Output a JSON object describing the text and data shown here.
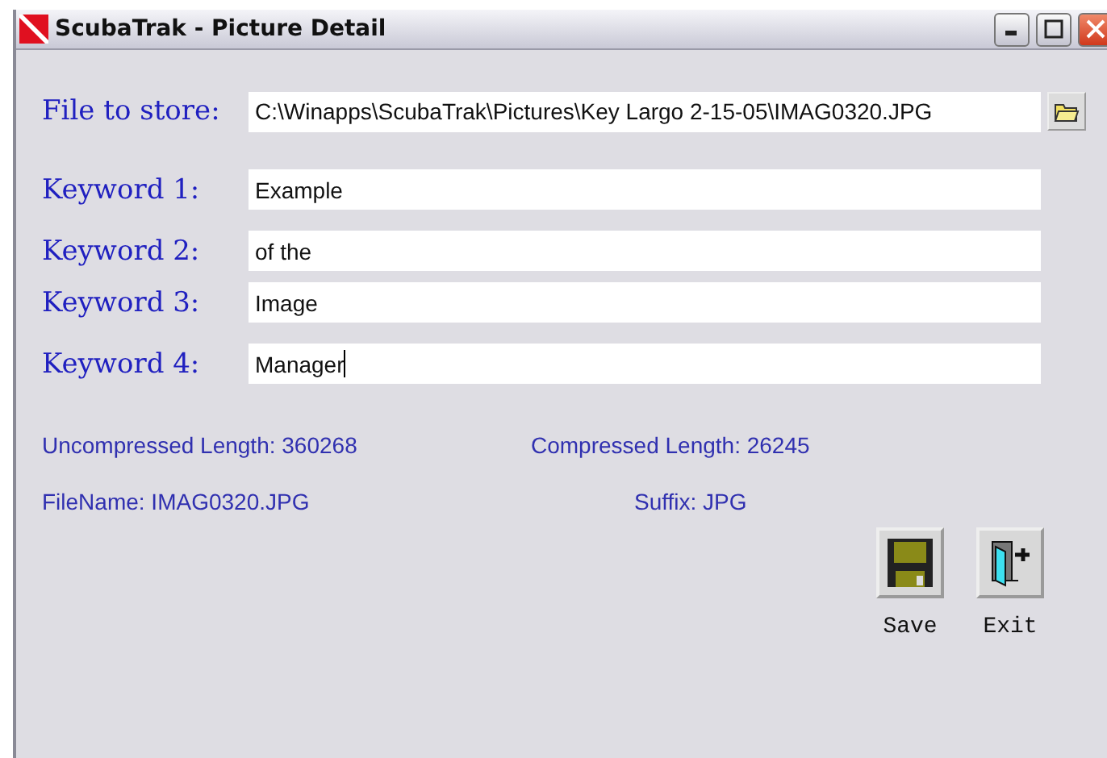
{
  "window": {
    "title": "ScubaTrak - Picture Detail"
  },
  "file_field": {
    "label": "File to store:",
    "value": "C:\\Winapps\\ScubaTrak\\Pictures\\Key Largo 2-15-05\\IMAG0320.JPG"
  },
  "keywords": [
    {
      "label": "Keyword 1:",
      "value": "Example",
      "focused": false
    },
    {
      "label": "Keyword 2:",
      "value": "of the",
      "focused": false
    },
    {
      "label": "Keyword 3:",
      "value": "Image",
      "focused": false
    },
    {
      "label": "Keyword 4:",
      "value": "Manager",
      "focused": true
    }
  ],
  "info": {
    "uncompressed": "Uncompressed Length: 360268",
    "compressed": "Compressed Length: 26245",
    "filename": "FileName: IMAG0320.JPG",
    "suffix": "Suffix: JPG"
  },
  "buttons": [
    {
      "kind": "save",
      "label": "Save"
    },
    {
      "kind": "exit",
      "label": "Exit"
    }
  ]
}
